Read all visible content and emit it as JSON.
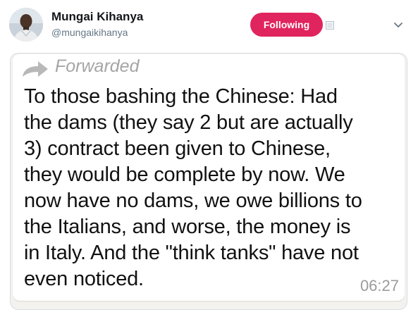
{
  "user": {
    "display_name": "Mungai Kihanya",
    "handle": "@mungaikihanya",
    "avatar_icon": "profile-photo"
  },
  "actions": {
    "follow_label": "Following",
    "follow_color": "#e0245e",
    "menu_icon": "chevron-down-icon"
  },
  "media": {
    "forwarded_label": "Forwarded",
    "message_text": "To those bashing the Chinese: Had\nthe dams (they say 2 but are actually\n3) contract been given to Chinese,\nthey would be complete by now. We\nnow have no dams, we owe billions to\nthe Italians, and worse, the money is\nin Italy. And the \"think tanks\" have not\neven noticed.",
    "time": "06:27"
  }
}
